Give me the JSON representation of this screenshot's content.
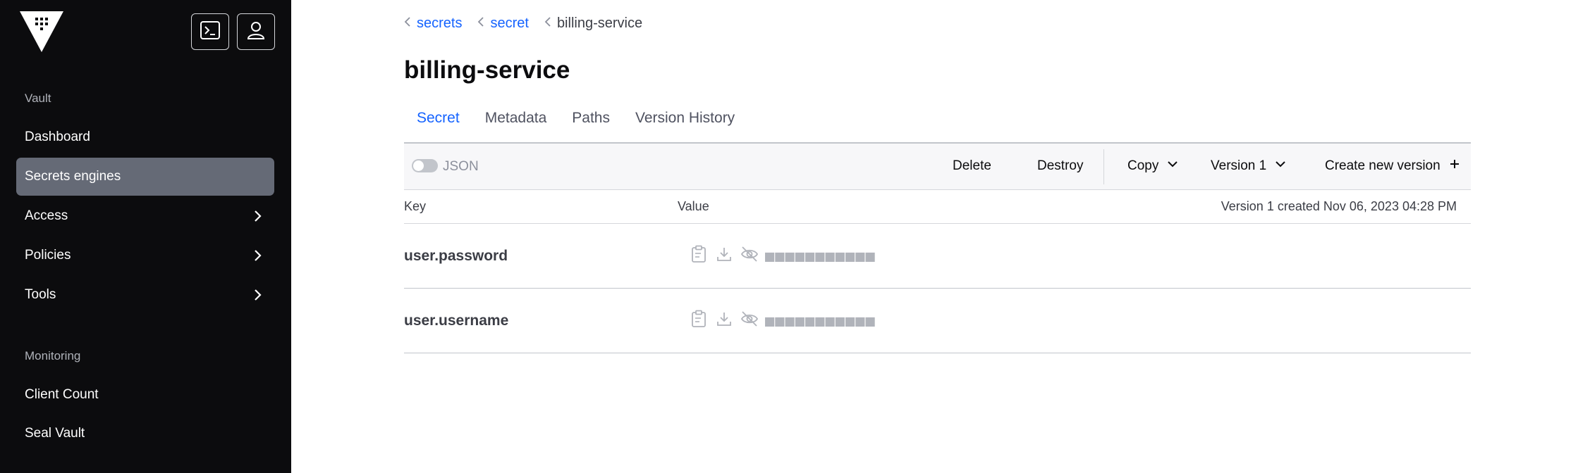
{
  "sidebar": {
    "sections": [
      {
        "title": "Vault",
        "items": [
          {
            "label": "Dashboard"
          },
          {
            "label": "Secrets engines",
            "active": true
          },
          {
            "label": "Access"
          },
          {
            "label": "Policies"
          },
          {
            "label": "Tools"
          }
        ]
      },
      {
        "title": "Monitoring",
        "items": [
          {
            "label": "Client Count"
          },
          {
            "label": "Seal Vault"
          }
        ]
      }
    ]
  },
  "breadcrumb": [
    {
      "label": "secrets"
    },
    {
      "label": "secret"
    },
    {
      "label": "billing-service"
    }
  ],
  "page_title": "billing-service",
  "tabs": [
    {
      "label": "Secret",
      "active": true
    },
    {
      "label": "Metadata"
    },
    {
      "label": "Paths"
    },
    {
      "label": "Version History"
    }
  ],
  "toolbar": {
    "json_label": "JSON",
    "delete_label": "Delete",
    "destroy_label": "Destroy",
    "copy_label": "Copy",
    "version_label": "Version 1",
    "create_label": "Create new version"
  },
  "table": {
    "key_header": "Key",
    "value_header": "Value",
    "meta": "Version 1 created Nov 06, 2023 04:28 PM",
    "rows": [
      {
        "key": "user.password",
        "masked": "■■■■■■■■■■■"
      },
      {
        "key": "user.username",
        "masked": "■■■■■■■■■■■"
      }
    ]
  },
  "colors": {
    "sidebar_bg": "#0c0c0e",
    "active_item": "#656a76",
    "link": "#1563ff"
  }
}
